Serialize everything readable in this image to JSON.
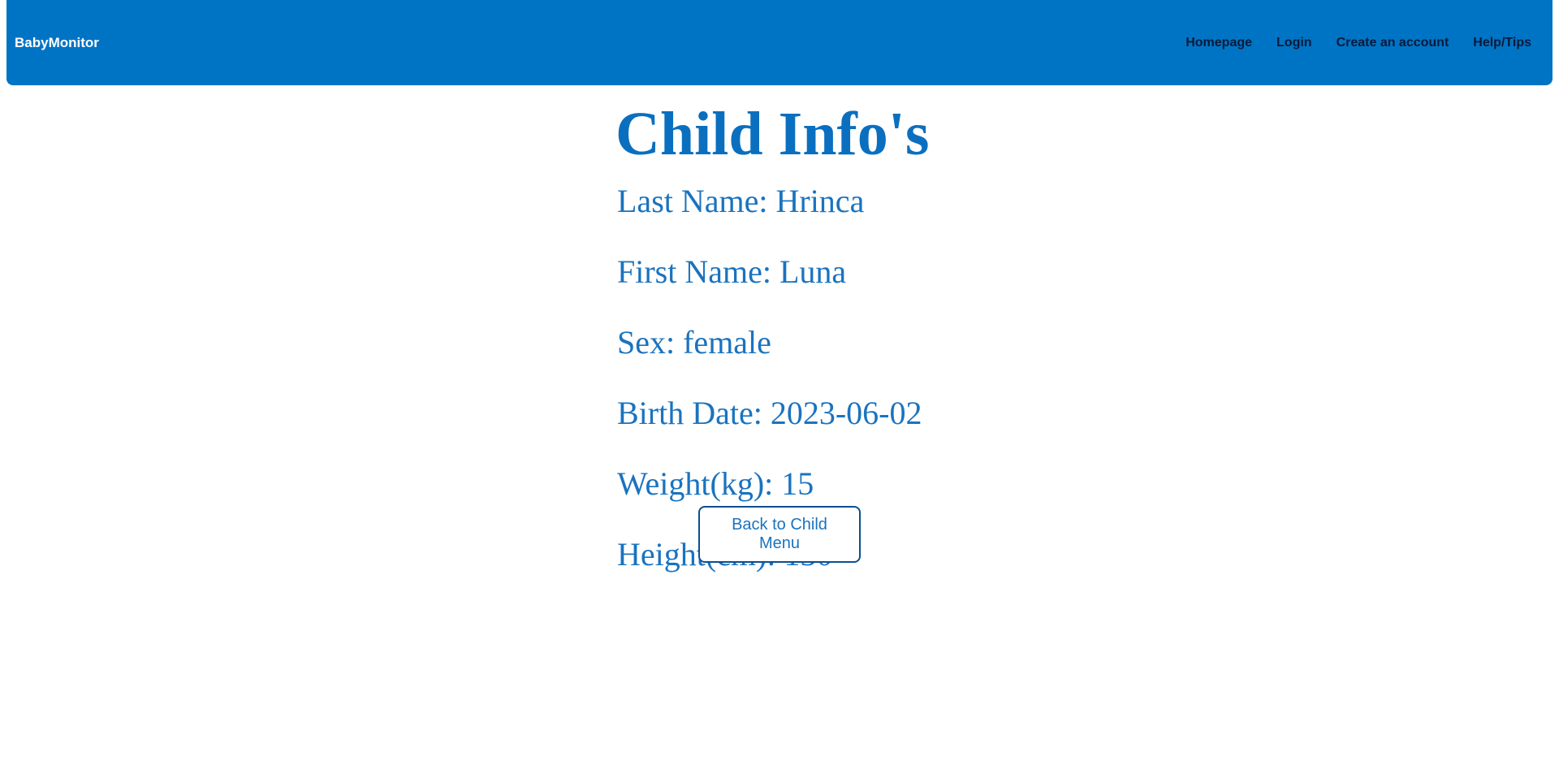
{
  "header": {
    "brand": "BabyMonitor",
    "nav": [
      {
        "label": "Homepage"
      },
      {
        "label": "Login"
      },
      {
        "label": "Create an account"
      },
      {
        "label": "Help/Tips"
      }
    ]
  },
  "main": {
    "title": "Child Info's",
    "fields": {
      "last_name": "Last Name: Hrinca",
      "first_name": "First Name: Luna",
      "sex": "Sex: female",
      "birth_date": "Birth Date: 2023-06-02",
      "weight": "Weight(kg): 15",
      "height": "Height(cm): 130"
    },
    "back_button_label": "Back to Child Menu"
  },
  "colors": {
    "navbar_bg": "#0074c4",
    "text_primary": "#1a73bf",
    "nav_link": "#0a1a3a"
  }
}
